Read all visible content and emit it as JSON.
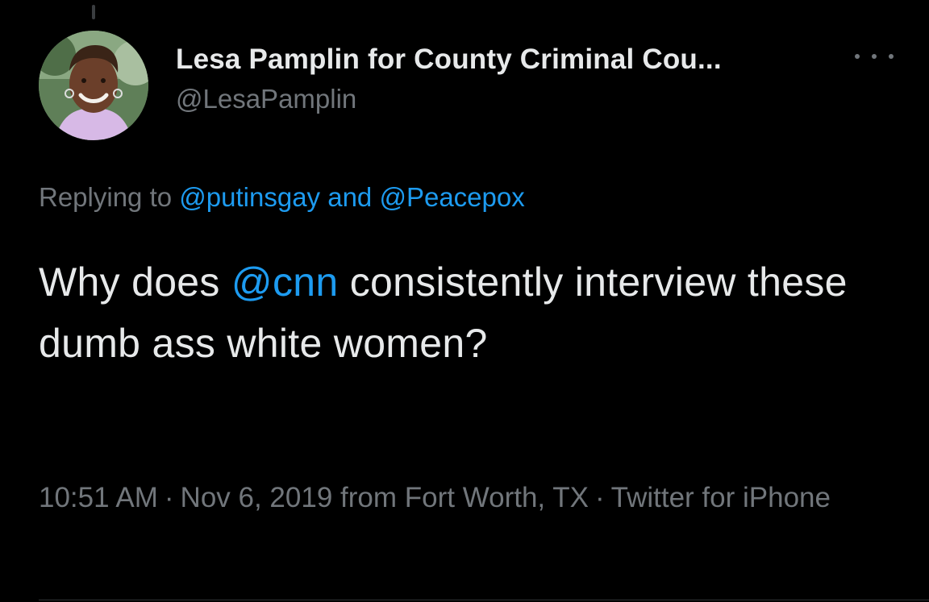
{
  "tweet": {
    "author": {
      "display_name": "Lesa Pamplin for County Criminal Cou...",
      "handle": "@LesaPamplin",
      "avatar_icon": "profile-photo"
    },
    "more_icon": "more-horizontal-icon",
    "replying": {
      "prefix": "Replying to",
      "mention_1": "@putinsgay",
      "conjunction": "and",
      "mention_2": "@Peacepox"
    },
    "text": {
      "part_1": "Why does",
      "mention": "@cnn",
      "part_2": "consistently interview these dumb ass white women?"
    },
    "meta": {
      "time": "10:51 AM",
      "separator": "·",
      "date": "Nov 6, 2019",
      "location": "from Fort Worth, TX",
      "source": "Twitter for iPhone"
    }
  },
  "colors": {
    "background": "#000000",
    "text": "#e7e9ea",
    "secondary": "#71767b",
    "link": "#1d9bf0"
  }
}
